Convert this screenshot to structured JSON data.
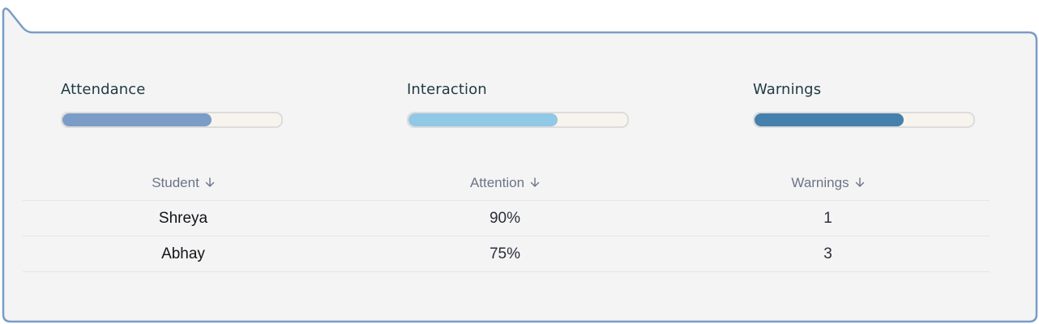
{
  "metrics": [
    {
      "label": "Attendance",
      "value": 0.68,
      "color": "#7a9cc6"
    },
    {
      "label": "Interaction",
      "value": 0.68,
      "color": "#90c8e6"
    },
    {
      "label": "Warnings",
      "value": 0.68,
      "color": "#4680ac"
    }
  ],
  "colors": {
    "frame_border": "#7a9cc6",
    "card_bg": "#f4f4f4",
    "track_bg": "#f6f4ec"
  },
  "table": {
    "headers": [
      {
        "label": "Student",
        "icon": "arrow-down-icon"
      },
      {
        "label": "Attention",
        "icon": "arrow-down-icon"
      },
      {
        "label": "Warnings",
        "icon": "arrow-down-icon"
      }
    ],
    "rows": [
      {
        "student": "Shreya",
        "attention": "90%",
        "warnings": "1"
      },
      {
        "student": "Abhay",
        "attention": "75%",
        "warnings": "3"
      }
    ]
  }
}
